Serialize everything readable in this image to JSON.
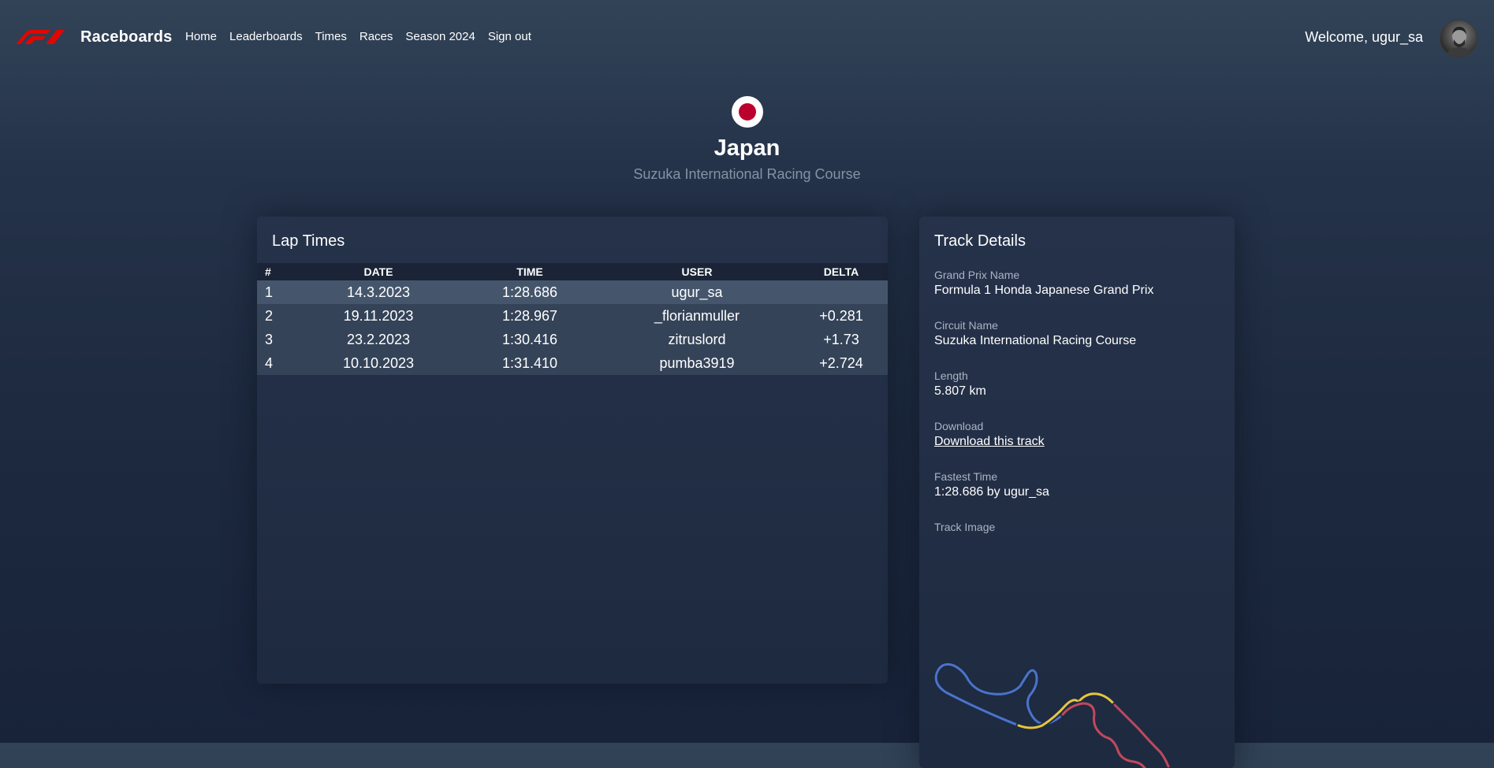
{
  "nav": {
    "brand": "Raceboards",
    "links": [
      "Home",
      "Leaderboards",
      "Times",
      "Races",
      "Season 2024",
      "Sign out"
    ],
    "welcome": "Welcome, ugur_sa"
  },
  "race": {
    "country": "Japan",
    "circuit": "Suzuka International Racing Course"
  },
  "lap_times": {
    "title": "Lap Times",
    "columns": [
      "#",
      "DATE",
      "TIME",
      "USER",
      "DELTA"
    ],
    "rows": [
      {
        "pos": "1",
        "date": "14.3.2023",
        "time": "1:28.686",
        "user": "ugur_sa",
        "delta": ""
      },
      {
        "pos": "2",
        "date": "19.11.2023",
        "time": "1:28.967",
        "user": "_florianmuller",
        "delta": "+0.281"
      },
      {
        "pos": "3",
        "date": "23.2.2023",
        "time": "1:30.416",
        "user": "zitruslord",
        "delta": "+1.73"
      },
      {
        "pos": "4",
        "date": "10.10.2023",
        "time": "1:31.410",
        "user": "pumba3919",
        "delta": "+2.724"
      }
    ]
  },
  "track_details": {
    "title": "Track Details",
    "grand_prix_label": "Grand Prix Name",
    "grand_prix_value": "Formula 1 Honda Japanese Grand Prix",
    "circuit_label": "Circuit Name",
    "circuit_value": "Suzuka International Racing Course",
    "length_label": "Length",
    "length_value": "5.807 km",
    "download_label": "Download",
    "download_link": "Download this track",
    "fastest_label": "Fastest Time",
    "fastest_value": "1:28.686 by ugur_sa",
    "image_label": "Track Image"
  },
  "colors": {
    "accent_red": "#e10600",
    "flag_red": "#bc002d",
    "track_blue": "#4a74c9",
    "track_yellow": "#e8c53a",
    "track_red": "#c0495a"
  },
  "icons": {
    "logo": "f1-logo",
    "avatar": "user-avatar",
    "flag": "japan-flag-icon"
  }
}
